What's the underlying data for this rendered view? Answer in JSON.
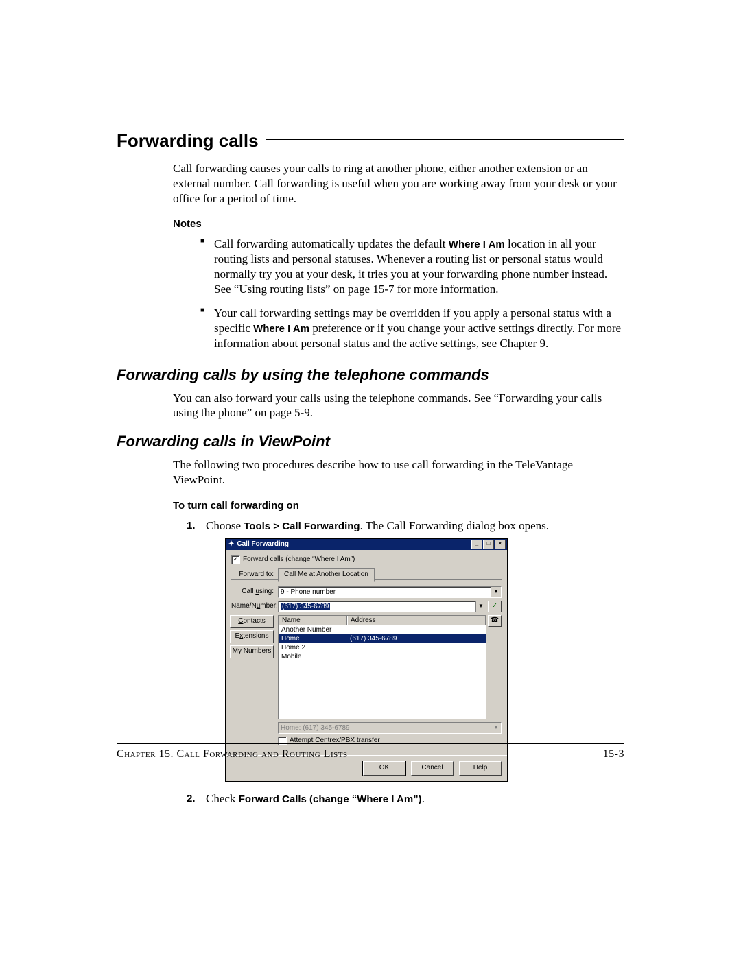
{
  "heading": "Forwarding calls",
  "intro": "Call forwarding causes your calls to ring at another phone, either another extension or an external number. Call forwarding is useful when you are working away from your desk or your office for a period of time.",
  "notes_label": "Notes",
  "notes": {
    "n1_a": "Call forwarding automatically updates the default ",
    "n1_b": "Where I Am",
    "n1_c": " location in all your routing lists and personal statuses. Whenever a routing list or personal status would normally try you at your desk, it tries you at your forwarding phone number instead. See “Using routing lists” on page 15-7 for more information.",
    "n2_a": "Your call forwarding settings may be overridden if you apply a personal status with a specific ",
    "n2_b": "Where I Am",
    "n2_c": " preference or if you change your active settings directly. For more information about personal status and the active settings, see Chapter 9."
  },
  "sub1": "Forwarding calls by using the telephone commands",
  "sub1_body": "You can also forward your calls using the telephone commands. See “Forwarding your calls using the phone” on page 5-9.",
  "sub2": "Forwarding calls in ViewPoint",
  "sub2_body": "The following two procedures describe how to use call forwarding in the TeleVantage ViewPoint.",
  "proc_label": "To turn call forwarding on",
  "step1_a": "Choose ",
  "step1_b": "Tools > Call Forwarding",
  "step1_c": ". The Call Forwarding dialog box opens.",
  "step2_a": "Check ",
  "step2_b": "Forward Calls (change “Where I Am”)",
  "step2_c": ".",
  "dialog": {
    "title": "Call Forwarding",
    "forward_calls_label": "Forward calls (change “Where I Am”)",
    "forward_to_label": "Forward to:",
    "tab_label": "Call Me at Another Location",
    "call_using_label": "Call using:",
    "call_using_value": "9 - Phone number",
    "name_number_label": "Name/Number:",
    "name_number_value": "(617) 345-6789",
    "btn_contacts": "Contacts",
    "btn_extensions": "Extensions",
    "btn_my_numbers": "My Numbers",
    "col_name": "Name",
    "col_address": "Address",
    "rows": [
      {
        "name": "Another Number",
        "address": ""
      },
      {
        "name": "Home",
        "address": "(617) 345-6789"
      },
      {
        "name": "Home 2",
        "address": ""
      },
      {
        "name": "Mobile",
        "address": ""
      }
    ],
    "selected_row": 1,
    "readonly_value": "Home:  (617) 345-6789",
    "centrex_label": "Attempt Centrex/PBX transfer",
    "btn_ok": "OK",
    "btn_cancel": "Cancel",
    "btn_help": "Help"
  },
  "footer_left": "Chapter 15. Call Forwarding and Routing Lists",
  "footer_right": "15-3"
}
